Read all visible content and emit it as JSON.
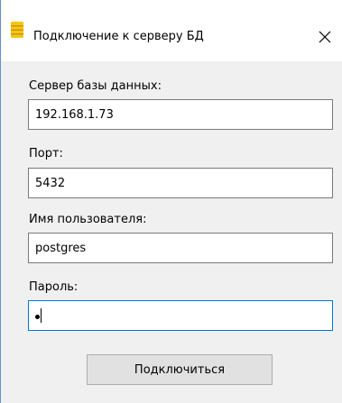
{
  "window": {
    "title": "Подключение к серверу БД",
    "icon": "database-icon",
    "close_icon": "close-icon",
    "close_glyph": "✕"
  },
  "form": {
    "server": {
      "label": "Сервер базы данных:",
      "value": "192.168.1.73"
    },
    "port": {
      "label": "Порт:",
      "value": "5432"
    },
    "username": {
      "label": "Имя пользователя:",
      "value": "postgres"
    },
    "password": {
      "label": "Пароль:",
      "masked_length": 1
    }
  },
  "actions": {
    "connect_label": "Подключиться"
  },
  "colors": {
    "accent": "#0078d7",
    "icon_yellow": "#f5c518"
  }
}
